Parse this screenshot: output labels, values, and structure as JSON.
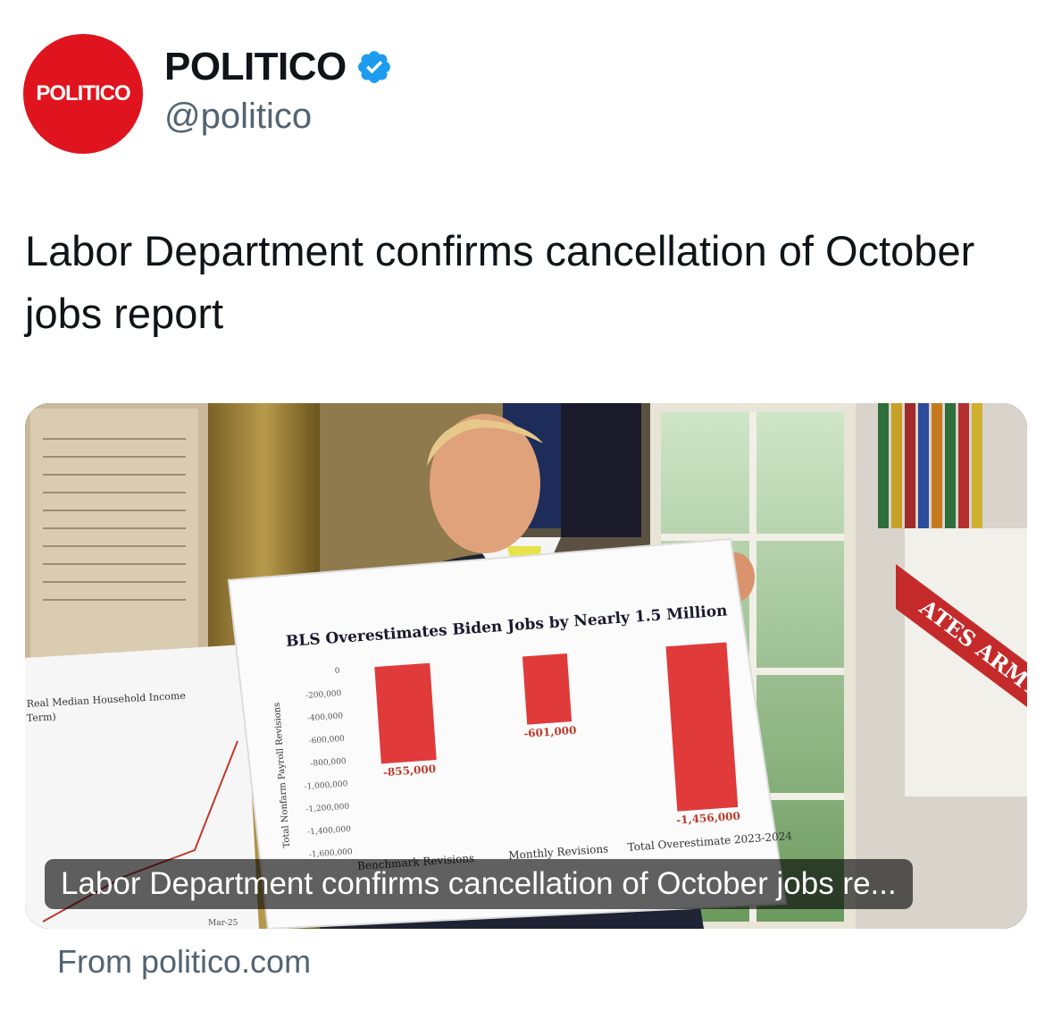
{
  "author": {
    "avatar_text": "POLITICO",
    "display_name": "POLITICO",
    "handle": "@politico",
    "verified": true,
    "avatar_color": "#e0141e",
    "verified_color": "#1d9bf0"
  },
  "tweet": {
    "text": "Labor Department confirms cancellation of October jobs report"
  },
  "card": {
    "title": "Labor Department confirms cancellation of October jobs re...",
    "source": "From politico.com",
    "image": {
      "sign": {
        "title": "BLS Overestimates Biden Jobs by Nearly 1.5 Million",
        "ylabel": "Total Nonfarm Payroll Revisions",
        "yticks": [
          "0",
          "-200,000",
          "-400,000",
          "-600,000",
          "-800,000",
          "-1,000,000",
          "-1,200,000",
          "-1,400,000",
          "-1,600,000"
        ],
        "categories": [
          "Benchmark Revisions",
          "Monthly Revisions",
          "Total Overestimate 2023-2024"
        ],
        "value_labels": [
          "-855,000",
          "-601,000",
          "-1,456,000"
        ],
        "values": [
          -855000,
          -601000,
          -1456000
        ],
        "bar_color": "#e03a3a"
      },
      "left_sign": {
        "title": "Real Median Household Income",
        "subtitle": "Term)",
        "xtick": "Mar-25"
      },
      "flag_text": "ATES ARMY"
    }
  }
}
